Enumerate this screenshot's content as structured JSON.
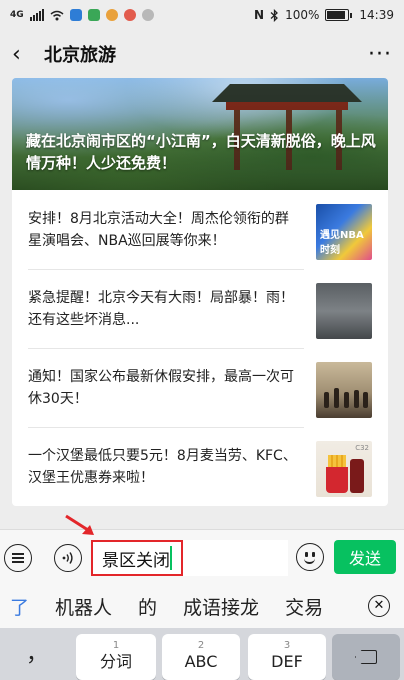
{
  "status_bar": {
    "network": "4G",
    "battery_percent": "100%",
    "time": "14:39"
  },
  "header": {
    "title": "北京旅游",
    "more_icon": "ellipsis-icon"
  },
  "hero": {
    "title": "藏在北京闹市区的“小江南”，白天清新脱俗，晚上风情万种！人少还免费！"
  },
  "articles": [
    {
      "title": "安排！8月北京活动大全！周杰伦领衔的群星演唱会、NBA巡回展等你来！",
      "thumb_text": "遇见NBA时刻"
    },
    {
      "title": "紧急提醒！北京今天有大雨！局部暴！雨！还有这些坏消息..."
    },
    {
      "title": "通知！国家公布最新休假安排，最高一次可休30天！"
    },
    {
      "title": "一个汉堡最低只要5元！8月麦当劳、KFC、汉堡王优惠券来啦！",
      "thumb_text": "C32"
    }
  ],
  "input_bar": {
    "text": "景区关闭",
    "send_label": "发送"
  },
  "suggestions": [
    "了",
    "机器人",
    "的",
    "成语接龙",
    "交易"
  ],
  "keyboard": {
    "punct_label": "，",
    "keys": [
      {
        "num": "1",
        "label": "分词"
      },
      {
        "num": "2",
        "label": "ABC"
      },
      {
        "num": "3",
        "label": "DEF"
      }
    ]
  },
  "colors": {
    "accent_green": "#07c160",
    "highlight_red": "#e3262a",
    "suggestion_blue": "#3b7be0"
  }
}
